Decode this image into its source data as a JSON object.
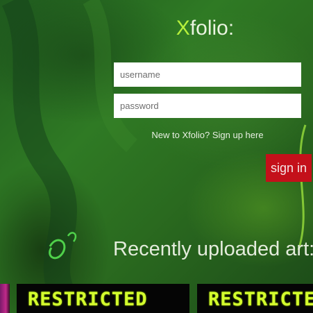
{
  "logo": {
    "accent": "X",
    "rest": "folio:"
  },
  "login": {
    "username_placeholder": "username",
    "password_placeholder": "password",
    "signup_text": "New to Xfolio? Sign up here",
    "signin_label": "sign in"
  },
  "recent": {
    "heading": "Recently uploaded art:",
    "tiles": [
      {
        "label": "RESTRICTED"
      },
      {
        "label": "RESTRICTED"
      }
    ]
  },
  "colors": {
    "accent": "#b6f03c",
    "signin_bg": "#c4101a",
    "restricted_text": "#d4ff2e"
  }
}
